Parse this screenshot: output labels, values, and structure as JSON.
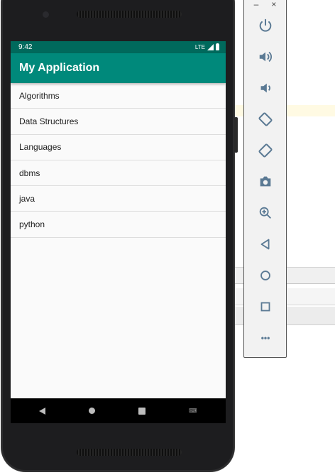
{
  "status_bar": {
    "time": "9:42",
    "network": "LTE"
  },
  "app_bar": {
    "title": "My Application"
  },
  "list": {
    "items": [
      "Algorithms",
      "Data Structures",
      "Languages",
      "dbms",
      "java",
      "python"
    ]
  },
  "nav_bar": {
    "keyboard_icon": "keyboard-icon"
  },
  "emulator_toolbar": {
    "minimize": "–",
    "close": "×",
    "buttons": [
      "power-icon",
      "volume-up-icon",
      "volume-down-icon",
      "rotate-left-icon",
      "rotate-right-icon",
      "camera-icon",
      "zoom-icon",
      "back-icon",
      "home-icon",
      "overview-icon",
      "more-icon"
    ],
    "more_label": "•••"
  },
  "colors": {
    "primary": "#00897b",
    "primary_dark": "#00695c",
    "icon": "#5b7a94"
  }
}
